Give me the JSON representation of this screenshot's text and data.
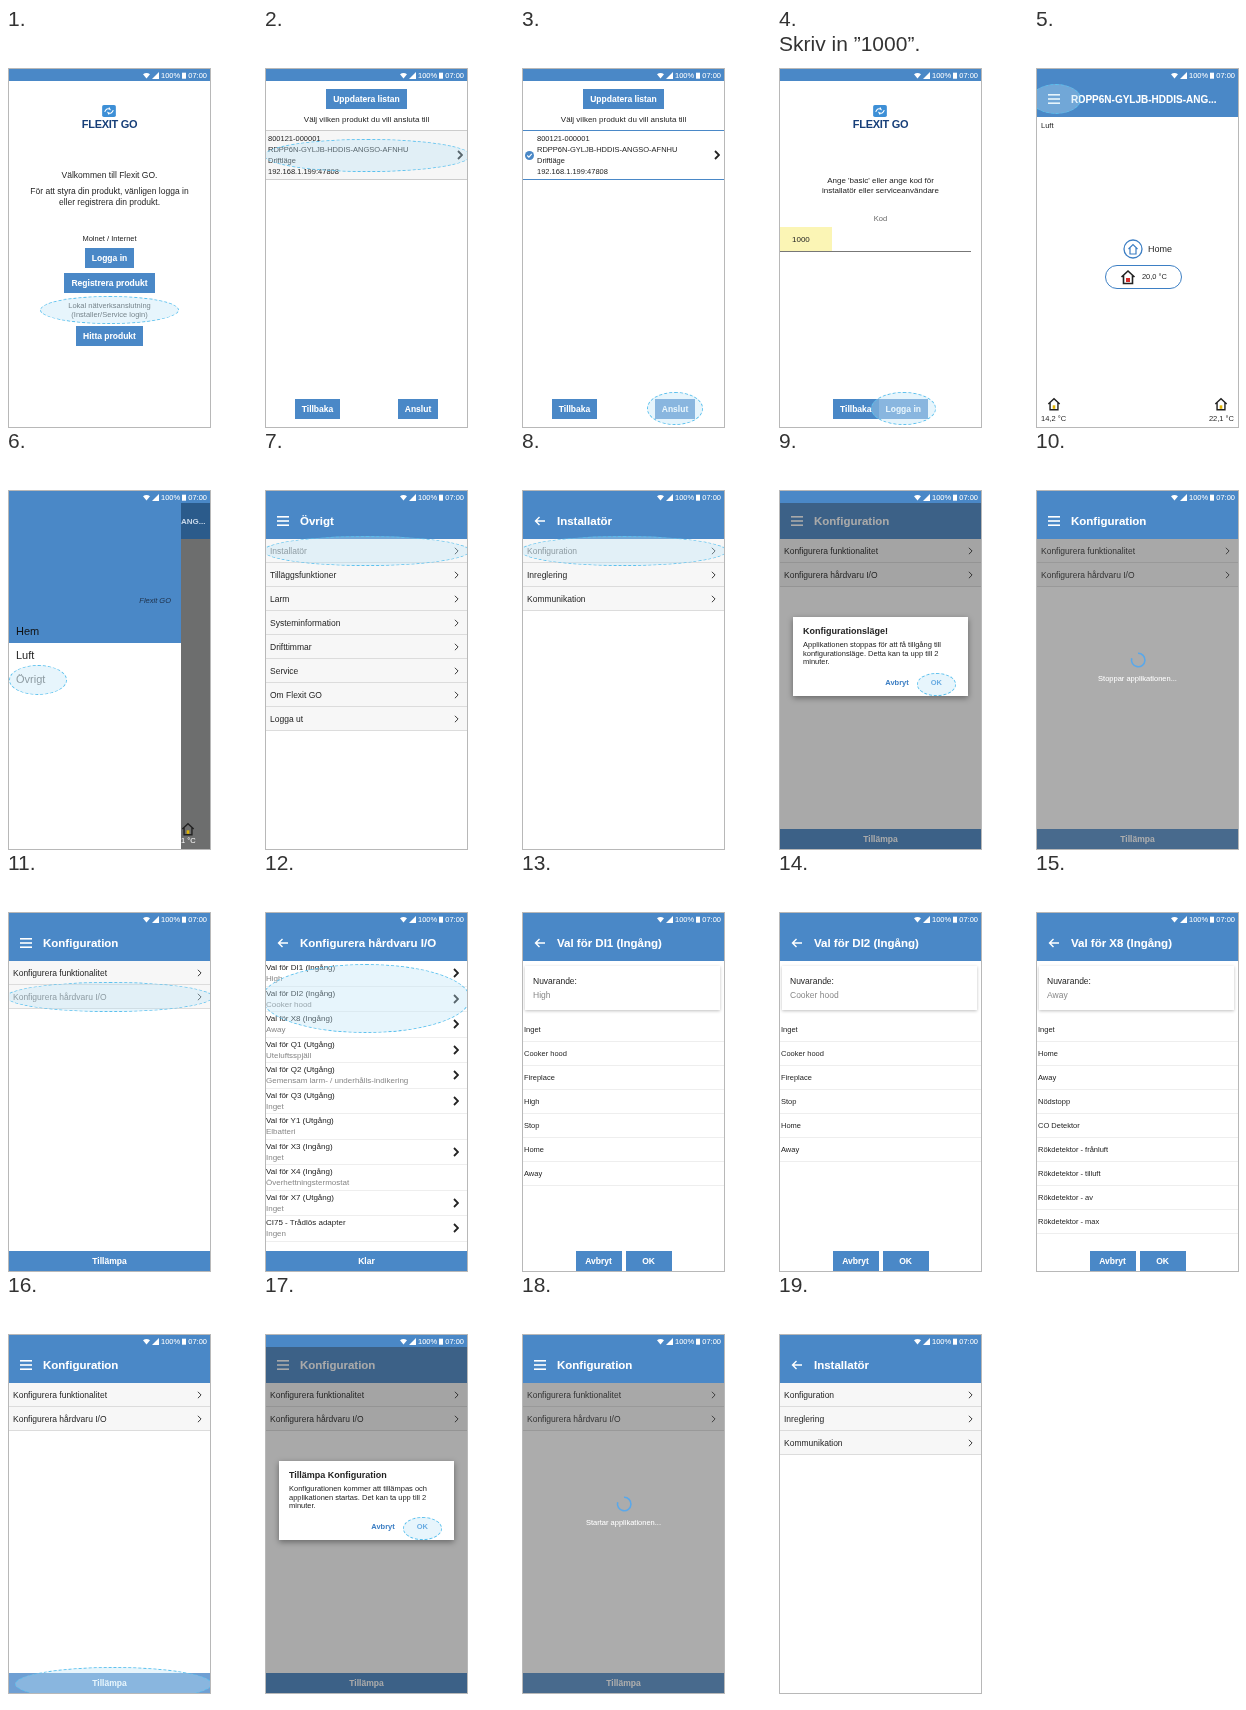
{
  "steps": [
    {
      "number": "1.",
      "screen": {
        "kind": "welcome",
        "status": {
          "battery": "100%",
          "time": "07:00"
        },
        "logo": "FLEXIT GO",
        "heading": "Välkommen till Flexit GO.",
        "text": "För att styra din produkt, vänligen logga in eller registrera din produkt.",
        "section_label": "Molnet / Internet",
        "buttons": [
          {
            "label": "Logga in"
          },
          {
            "label": "Registrera produkt"
          }
        ],
        "local_label": [
          "Lokal nätverksanslutning",
          "(Installer/Service login)"
        ],
        "local_highlighted": true,
        "local_button": "Hitta produkt"
      }
    },
    {
      "number": "2.",
      "screen": {
        "kind": "product_list",
        "status": {
          "battery": "100%",
          "time": "07:00"
        },
        "top_button": "Uppdatera listan",
        "prompt": "Välj vilken produkt du vill ansluta till",
        "product": {
          "lines": [
            "800121-000001",
            "RDPP6N-GYLJB-HDDIS-ANGSO-AFNHU",
            "Driftläge",
            "192.168.1.199:47808"
          ],
          "selected": false,
          "highlighted": true
        },
        "buttons": [
          {
            "label": "Tillbaka",
            "highlighted": false
          },
          {
            "label": "Anslut",
            "highlighted": false
          }
        ]
      }
    },
    {
      "number": "3.",
      "screen": {
        "kind": "product_list",
        "status": {
          "battery": "100%",
          "time": "07:00"
        },
        "top_button": "Uppdatera listan",
        "prompt": "Välj vilken produkt du vill ansluta till",
        "product": {
          "lines": [
            "800121-000001",
            "RDPP6N-GYLJB-HDDIS-ANGSO-AFNHU",
            "Driftläge",
            "192.168.1.199:47808"
          ],
          "selected": true,
          "highlighted": false
        },
        "buttons": [
          {
            "label": "Tillbaka",
            "highlighted": false
          },
          {
            "label": "Anslut",
            "highlighted": true
          }
        ]
      }
    },
    {
      "number": "4.",
      "caption": "Skriv in ”1000”.",
      "screen": {
        "kind": "login",
        "status": {
          "battery": "100%",
          "time": "07:00"
        },
        "logo": "FLEXIT GO",
        "prompt": "Ange 'basic' eller ange kod för installatör eller serviceanvändare",
        "field_label": "Kod",
        "field_value": "1000",
        "field_highlighted": true,
        "buttons": [
          {
            "label": "Tillbaka",
            "highlighted": false
          },
          {
            "label": "Logga in",
            "highlighted": true
          }
        ]
      }
    },
    {
      "number": "5.",
      "screen": {
        "kind": "home",
        "status": {
          "battery": "100%",
          "time": "07:00"
        },
        "nav": {
          "kind": "menu",
          "highlighted": true
        },
        "title": "RDPP6N-GYLJB-HDDIS-ANG...",
        "section": "Luft",
        "mode": "Home",
        "temperature": "20,0 °C",
        "corner_temperatures": [
          "14,2 °C",
          "22,1 °C"
        ]
      }
    },
    {
      "number": "6.",
      "screen": {
        "kind": "drawer",
        "status": {
          "battery": "100%",
          "time": "07:00"
        },
        "brand": "Flexit GO",
        "items": [
          {
            "label": "Hem",
            "selected": true,
            "highlighted": false
          },
          {
            "label": "Luft",
            "selected": false,
            "highlighted": false
          },
          {
            "label": "Övrigt",
            "selected": false,
            "highlighted": true
          }
        ],
        "behind_title": "ANG...",
        "behind_temperature": "1 °C"
      }
    },
    {
      "number": "7.",
      "screen": {
        "kind": "list",
        "status": {
          "battery": "100%",
          "time": "07:00"
        },
        "nav": {
          "kind": "menu"
        },
        "title": "Övrigt",
        "items": [
          {
            "label": "Installatör",
            "highlighted": true
          },
          {
            "label": "Tilläggsfunktioner",
            "highlighted": false
          },
          {
            "label": "Larm",
            "highlighted": false
          },
          {
            "label": "Systeminformation",
            "highlighted": false
          },
          {
            "label": "Drifttimmar",
            "highlighted": false
          },
          {
            "label": "Service",
            "highlighted": false
          },
          {
            "label": "Om Flexit GO",
            "highlighted": false
          },
          {
            "label": "Logga ut",
            "highlighted": false
          }
        ]
      }
    },
    {
      "number": "8.",
      "screen": {
        "kind": "list",
        "status": {
          "battery": "100%",
          "time": "07:00"
        },
        "nav": {
          "kind": "back"
        },
        "title": "Installatör",
        "items": [
          {
            "label": "Konfiguration",
            "highlighted": true
          },
          {
            "label": "Inreglering",
            "highlighted": false
          },
          {
            "label": "Kommunikation",
            "highlighted": false
          }
        ]
      }
    },
    {
      "number": "9.",
      "screen": {
        "kind": "list",
        "status": {
          "battery": "100%",
          "time": "07:00"
        },
        "nav": {
          "kind": "menu"
        },
        "title": "Konfiguration",
        "items": [
          {
            "label": "Konfigurera funktionalitet",
            "highlighted": false
          },
          {
            "label": "Konfigurera hårdvaru I/O",
            "highlighted": false
          }
        ],
        "bottom_bar": {
          "label": "Tillämpa",
          "highlighted": false
        },
        "dialog": {
          "title": "Konfigurationsläge!",
          "text": "Applikationen stoppas för att få tillgång till konfigurationsläge. Detta kan ta upp till 2 minuter.",
          "buttons": [
            {
              "label": "Avbryt",
              "highlighted": false
            },
            {
              "label": "OK",
              "highlighted": true
            }
          ]
        }
      }
    },
    {
      "number": "10.",
      "screen": {
        "kind": "list",
        "status": {
          "battery": "100%",
          "time": "07:00"
        },
        "nav": {
          "kind": "menu"
        },
        "title": "Konfiguration",
        "items": [
          {
            "label": "Konfigurera funktionalitet",
            "highlighted": false
          },
          {
            "label": "Konfigurera hårdvaru I/O",
            "highlighted": false
          }
        ],
        "bottom_bar": {
          "label": "Tillämpa",
          "highlighted": false
        },
        "spinner": "Stoppar applikationen..."
      }
    },
    {
      "number": "11.",
      "screen": {
        "kind": "list",
        "status": {
          "battery": "100%",
          "time": "07:00"
        },
        "nav": {
          "kind": "menu"
        },
        "title": "Konfiguration",
        "items": [
          {
            "label": "Konfigurera funktionalitet",
            "highlighted": false
          },
          {
            "label": "Konfigurera hårdvaru I/O",
            "highlighted": true
          }
        ],
        "bottom_bar": {
          "label": "Tillämpa",
          "highlighted": false
        }
      }
    },
    {
      "number": "12.",
      "screen": {
        "kind": "io_list",
        "status": {
          "battery": "100%",
          "time": "07:00"
        },
        "nav": {
          "kind": "back"
        },
        "title": "Konfigurera hårdvaru I/O",
        "items": [
          {
            "label": "Val för DI1 (Ingång)",
            "value": "High",
            "chevron": true,
            "highlighted": true
          },
          {
            "label": "Val för DI2 (Ingång)",
            "value": "Cooker hood",
            "chevron": true,
            "highlighted": true
          },
          {
            "label": "Val för X8 (Ingång)",
            "value": "Away",
            "chevron": true,
            "highlighted": true
          },
          {
            "label": "Val för Q1 (Utgång)",
            "value": "Uteluftsspjäll",
            "chevron": true,
            "highlighted": false
          },
          {
            "label": "Val för Q2 (Utgång)",
            "value": "Gemensam larm- / underhålls-indikering",
            "chevron": true,
            "highlighted": false
          },
          {
            "label": "Val för Q3 (Utgång)",
            "value": "Inget",
            "chevron": true,
            "highlighted": false
          },
          {
            "label": "Val för Y1 (Utgång)",
            "value": "Elbatteri",
            "chevron": false,
            "highlighted": false
          },
          {
            "label": "Val för X3 (Ingång)",
            "value": "Inget",
            "chevron": true,
            "highlighted": false
          },
          {
            "label": "Val för X4 (Ingång)",
            "value": "Överhettningstermostat",
            "chevron": false,
            "highlighted": false
          },
          {
            "label": "Val för X7 (Utgång)",
            "value": "Inget",
            "chevron": true,
            "highlighted": false
          },
          {
            "label": "CI75 - Trådlös adapter",
            "value": "Ingen",
            "chevron": true,
            "highlighted": false
          }
        ],
        "bottom_bar": {
          "label": "Klar",
          "highlighted": false
        }
      }
    },
    {
      "number": "13.",
      "screen": {
        "kind": "options",
        "status": {
          "battery": "100%",
          "time": "07:00"
        },
        "nav": {
          "kind": "back"
        },
        "title": "Val för DI1 (Ingång)",
        "current_label": "Nuvarande:",
        "current_value": "High",
        "options": [
          "Inget",
          "Cooker hood",
          "Fireplace",
          "High",
          "Stop",
          "Home",
          "Away"
        ],
        "buttons": [
          {
            "label": "Avbryt",
            "highlighted": false
          },
          {
            "label": "OK",
            "highlighted": false
          }
        ]
      }
    },
    {
      "number": "14.",
      "screen": {
        "kind": "options",
        "status": {
          "battery": "100%",
          "time": "07:00"
        },
        "nav": {
          "kind": "back"
        },
        "title": "Val för DI2 (Ingång)",
        "current_label": "Nuvarande:",
        "current_value": "Cooker hood",
        "options": [
          "Inget",
          "Cooker hood",
          "Fireplace",
          "Stop",
          "Home",
          "Away"
        ],
        "buttons": [
          {
            "label": "Avbryt",
            "highlighted": false
          },
          {
            "label": "OK",
            "highlighted": false
          }
        ]
      }
    },
    {
      "number": "15.",
      "screen": {
        "kind": "options",
        "status": {
          "battery": "100%",
          "time": "07:00"
        },
        "nav": {
          "kind": "back"
        },
        "title": "Val för X8 (Ingång)",
        "current_label": "Nuvarande:",
        "current_value": "Away",
        "options": [
          "Inget",
          "Home",
          "Away",
          "Nödstopp",
          "CO Detektor",
          "Rökdetektor - frånluft",
          "Rökdetektor - tilluft",
          "Rökdetektor - av",
          "Rökdetektor - max"
        ],
        "buttons": [
          {
            "label": "Avbryt",
            "highlighted": false
          },
          {
            "label": "OK",
            "highlighted": false
          }
        ]
      }
    },
    {
      "number": "16.",
      "screen": {
        "kind": "list",
        "status": {
          "battery": "100%",
          "time": "07:00"
        },
        "nav": {
          "kind": "menu"
        },
        "title": "Konfiguration",
        "items": [
          {
            "label": "Konfigurera funktionalitet",
            "highlighted": false
          },
          {
            "label": "Konfigurera hårdvaru I/O",
            "highlighted": false
          }
        ],
        "bottom_bar": {
          "label": "Tillämpa",
          "highlighted": true
        }
      }
    },
    {
      "number": "17.",
      "screen": {
        "kind": "list",
        "status": {
          "battery": "100%",
          "time": "07:00"
        },
        "nav": {
          "kind": "menu"
        },
        "title": "Konfiguration",
        "items": [
          {
            "label": "Konfigurera funktionalitet",
            "highlighted": false
          },
          {
            "label": "Konfigurera hårdvaru I/O",
            "highlighted": false
          }
        ],
        "bottom_bar": {
          "label": "Tillämpa",
          "highlighted": false
        },
        "dialog": {
          "title": "Tillämpa Konfiguration",
          "text": "Konfigurationen kommer att tillämpas och applikationen startas. Det kan ta upp till 2 minuter.",
          "buttons": [
            {
              "label": "Avbryt",
              "highlighted": false
            },
            {
              "label": "OK",
              "highlighted": true
            }
          ]
        }
      }
    },
    {
      "number": "18.",
      "screen": {
        "kind": "list",
        "status": {
          "battery": "100%",
          "time": "07:00"
        },
        "nav": {
          "kind": "menu"
        },
        "title": "Konfiguration",
        "items": [
          {
            "label": "Konfigurera funktionalitet",
            "highlighted": false
          },
          {
            "label": "Konfigurera hårdvaru I/O",
            "highlighted": false
          }
        ],
        "bottom_bar": {
          "label": "Tillämpa",
          "highlighted": false
        },
        "spinner": "Startar applikationen..."
      }
    },
    {
      "number": "19.",
      "screen": {
        "kind": "list",
        "status": {
          "battery": "100%",
          "time": "07:00"
        },
        "nav": {
          "kind": "back"
        },
        "title": "Installatör",
        "items": [
          {
            "label": "Konfiguration",
            "highlighted": false
          },
          {
            "label": "Inreglering",
            "highlighted": false
          },
          {
            "label": "Kommunikation",
            "highlighted": false
          }
        ]
      }
    }
  ]
}
